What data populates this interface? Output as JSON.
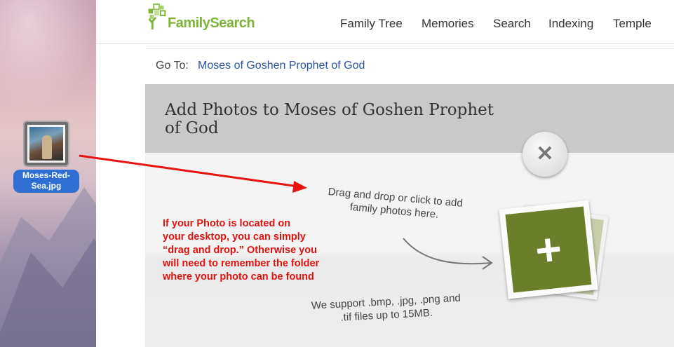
{
  "desktop": {
    "file_label_line1": "Moses-Red-",
    "file_label_line2": "Sea.jpg"
  },
  "header": {
    "logo_text": "FamilySearch",
    "nav": [
      "Family Tree",
      "Memories",
      "Search",
      "Indexing",
      "Temple"
    ]
  },
  "goto": {
    "label": "Go To:",
    "link": "Moses of Goshen Prophet of God"
  },
  "dialog": {
    "title_line1": "Add Photos to Moses of Goshen Prophet",
    "title_line2": "of God",
    "close_icon": "close-icon",
    "drag_line1": "Drag and drop or click to add",
    "drag_line2": "family photos here.",
    "support_line1": "We support .bmp, .jpg, .png and",
    "support_line2": ".tif files up to 15MB.",
    "add_icon": "plus-icon"
  },
  "annotation": {
    "lines": [
      "If your Photo is located on",
      "your desktop, you can simply",
      "“drag and drop.” Otherwise you",
      "will need to remember the folder",
      "where your photo can be found"
    ],
    "arrow_color": "#e8120f"
  },
  "colors": {
    "brand_green": "#7db33b",
    "link_blue": "#2a55a3",
    "header_gray": "#c9c9c9",
    "photo_green": "#6b7f2a",
    "annotation_red": "#e0120f"
  }
}
